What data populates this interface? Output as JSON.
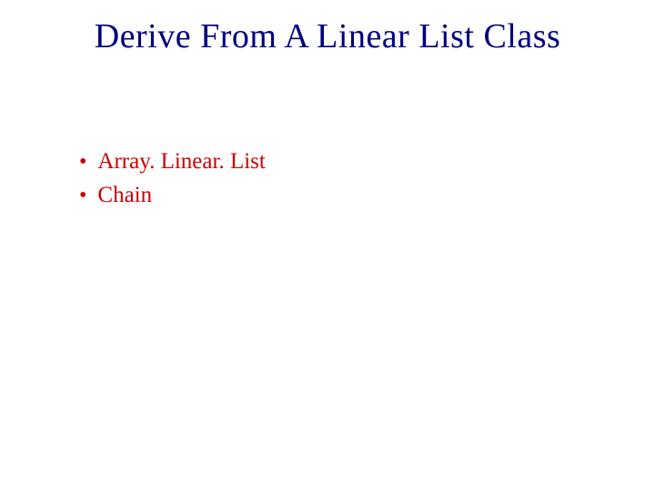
{
  "slide": {
    "title": "Derive From A Linear List Class",
    "bullets": [
      "Array. Linear. List",
      "Chain"
    ]
  }
}
